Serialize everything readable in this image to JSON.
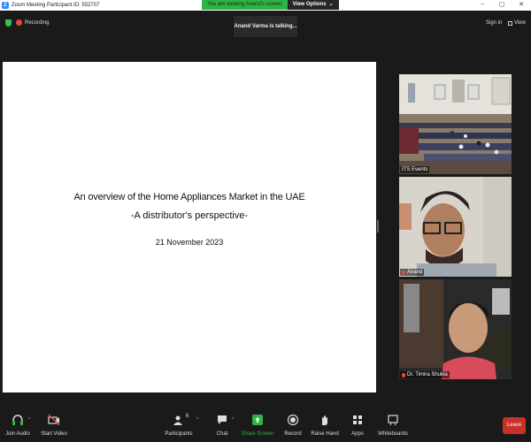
{
  "window": {
    "title": "Zoom Meeting Participant ID: 552707",
    "logo_letter": "Z",
    "controls": [
      "−",
      "▢",
      "✕"
    ]
  },
  "share_banner": {
    "status": "You are viewing Anand's screen",
    "options_label": "View Options",
    "options_caret": "⌄"
  },
  "topbar": {
    "recording_label": "Recording",
    "talking_label": "Anand Varma is talking...",
    "signin_label": "Sign in",
    "view_label": "View"
  },
  "slide": {
    "title_line1": "An overview of the Home Appliances Market in the UAE",
    "title_line2": "-A distributor's perspective-",
    "date": "21 November 2023"
  },
  "participants": [
    {
      "name": "ITS Events"
    },
    {
      "name": "Anand"
    },
    {
      "name": "Dr. Timira Shukla"
    }
  ],
  "toolbar": {
    "join_audio": "Join Audio",
    "start_video": "Start Video",
    "participants": "Participants",
    "participant_count": "6",
    "chat": "Chat",
    "share_screen": "Share Screen",
    "record": "Record",
    "raise_hand": "Raise Hand",
    "apps": "Apps",
    "whiteboards": "Whiteboards",
    "leave": "Leave",
    "caret": "^"
  },
  "colors": {
    "accent_green": "#2fb344",
    "leave_red": "#c8302a",
    "zoom_blue": "#2d8cff"
  }
}
